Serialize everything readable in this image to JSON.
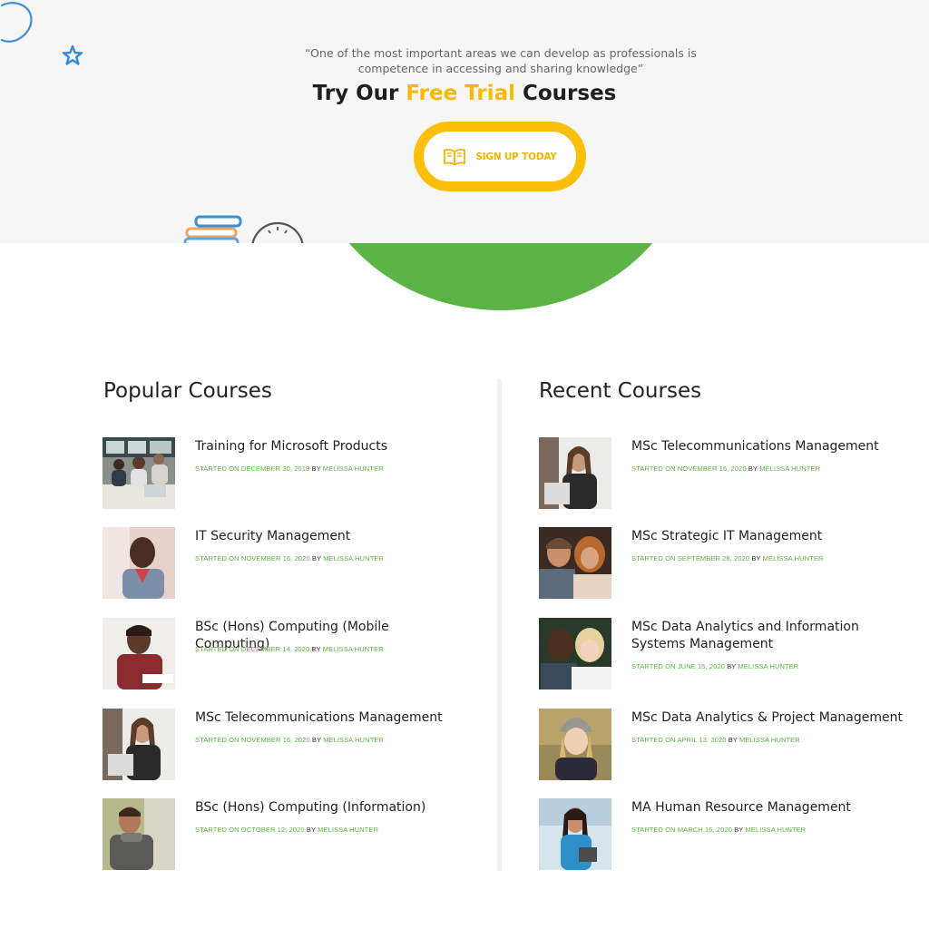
{
  "hero": {
    "quote": "“One of the most important areas we can develop as professionals is competence in accessing and sharing knowledge”",
    "headline_pre": "Try Our ",
    "headline_accent": "Free Trial",
    "headline_post": " Courses",
    "cta_label": "SIGN UP TODAY",
    "accent_color": "#fbbf0a",
    "green_color": "#5db446"
  },
  "popular": {
    "title": "Popular Courses",
    "items": [
      {
        "title": "Training for Microsoft Products",
        "date": "STARTED ON DECEMBER 30, 2019",
        "by": "BY",
        "author": "MELISSA HUNTER"
      },
      {
        "title": "IT Security Management",
        "date": "STARTED ON NOVEMBER 16, 2020",
        "by": "BY",
        "author": "MELISSA HUNTER"
      },
      {
        "title": "BSc (Hons) Computing (Mobile Computing)",
        "date": "STARTED ON DECEMBER 14, 2020",
        "by": "BY",
        "author": "MELISSA HUNTER"
      },
      {
        "title": "MSc Telecommunications Management",
        "date": "STARTED ON NOVEMBER 16, 2020",
        "by": "BY",
        "author": "MELISSA HUNTER"
      },
      {
        "title": "BSc (Hons) Computing (Information)",
        "date": "STARTED ON OCTOBER 12, 2020",
        "by": "BY",
        "author": "MELISSA HUNTER"
      }
    ]
  },
  "recent": {
    "title": "Recent Courses",
    "items": [
      {
        "title": "MSc Telecommunications Management",
        "date": "STARTED ON NOVEMBER 16, 2020",
        "by": "BY",
        "author": "MELISSA HUNTER"
      },
      {
        "title": "MSc Strategic IT Management",
        "date": "STARTED ON SEPTEMBER 28, 2020",
        "by": "BY",
        "author": "MELISSA HUNTER"
      },
      {
        "title": "MSc Data Analytics and Information Systems Management",
        "date": "STARTED ON JUNE 15, 2020",
        "by": "BY",
        "author": "MELISSA HUNTER"
      },
      {
        "title": "MSc Data Analytics & Project Management",
        "date": "STARTED ON APRIL 13, 2020",
        "by": "BY",
        "author": "MELISSA HUNTER"
      },
      {
        "title": "MA Human Resource Management",
        "date": "STARTED ON MARCH 16, 2020",
        "by": "BY",
        "author": "MELISSA HUNTER"
      }
    ]
  },
  "icons": {
    "cta": "open-book-icon",
    "decorations": [
      "doodle-loop-icon",
      "star-icon",
      "books-stack-icon",
      "clock-icon"
    ]
  }
}
